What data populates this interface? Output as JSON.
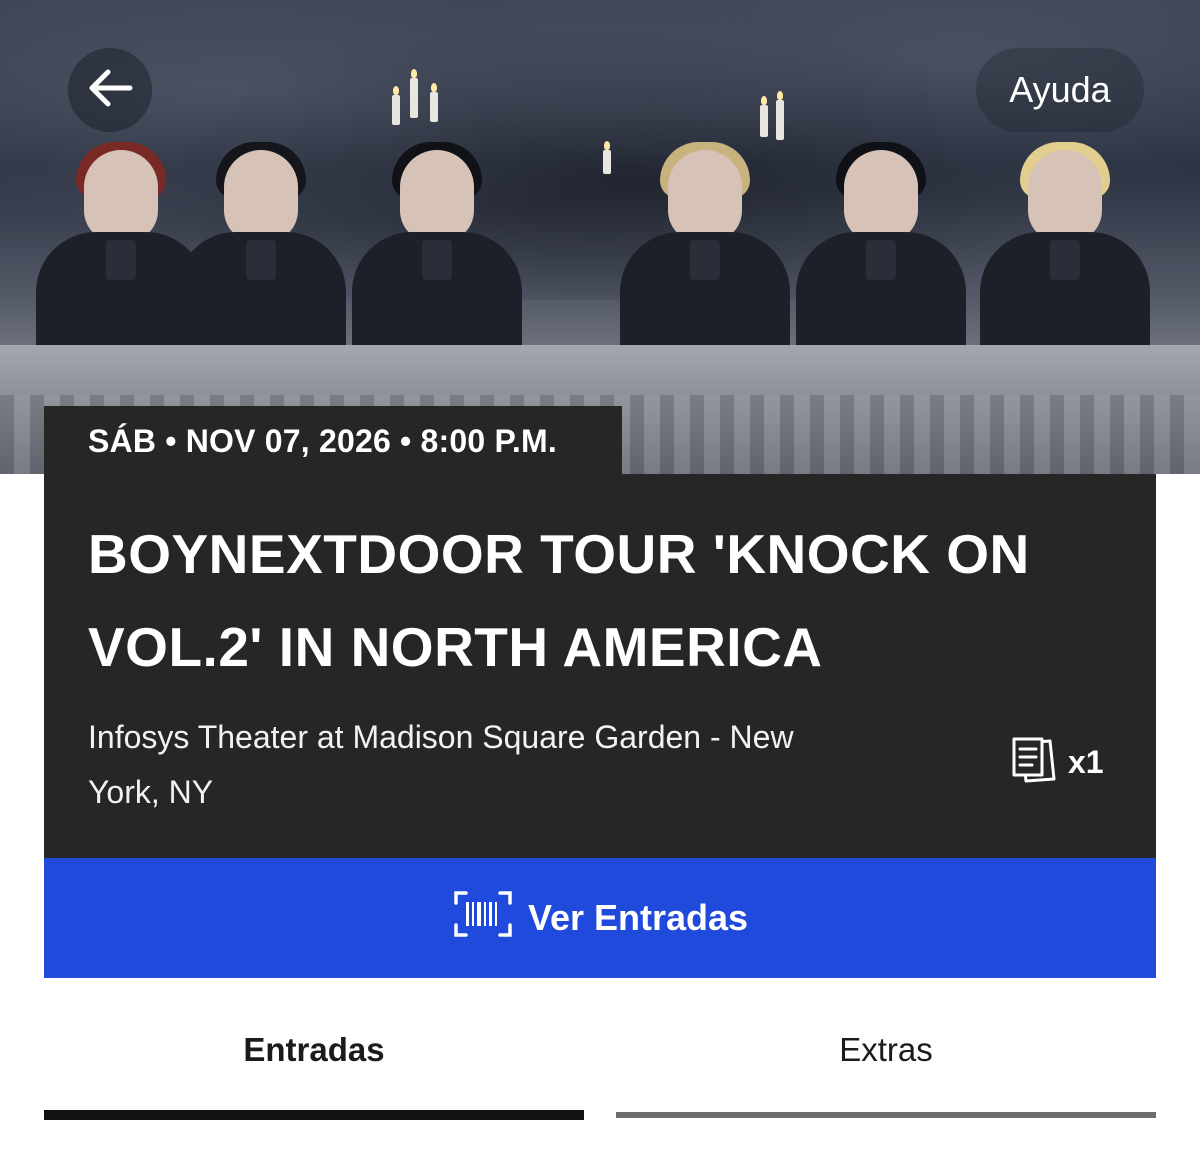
{
  "header": {
    "back_icon": "arrow-left-icon",
    "help_label": "Ayuda"
  },
  "hero": {
    "image": "band-photo"
  },
  "event": {
    "date_line": "SÁB • NOV 07, 2026 • 8:00 P.M.",
    "title_line1": "BOYNEXTDOOR TOUR 'KNOCK ON",
    "title_line2": "VOL.2' IN NORTH AMERICA",
    "venue_line1": "Infosys Theater at Madison Square Garden - New",
    "venue_line2": "York, NY",
    "ticket_icon": "tickets-icon",
    "ticket_quantity": "x1"
  },
  "actions": {
    "view_tickets_icon": "barcode-scan-icon",
    "view_tickets_label": "Ver Entradas"
  },
  "tabs": [
    {
      "label": "Entradas",
      "active": true
    },
    {
      "label": "Extras",
      "active": false
    }
  ],
  "colors": {
    "card_bg": "#262626",
    "button_blue": "#1f4adb",
    "active_tab": "#111111",
    "inactive_tab": "#6e6e6e"
  }
}
